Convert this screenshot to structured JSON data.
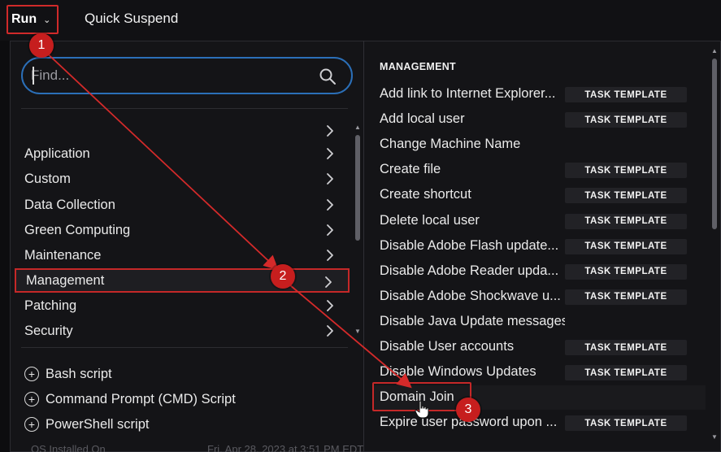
{
  "topbar": {
    "run_label": "Run",
    "quick_suspend_label": "Quick Suspend"
  },
  "search": {
    "placeholder": "Find..."
  },
  "categories": [
    {
      "label": ""
    },
    {
      "label": "Application"
    },
    {
      "label": "Custom"
    },
    {
      "label": "Data Collection"
    },
    {
      "label": "Green Computing"
    },
    {
      "label": "Maintenance"
    },
    {
      "label": "Management",
      "selected": true
    },
    {
      "label": "Patching"
    },
    {
      "label": "Security"
    }
  ],
  "scripts": [
    {
      "label": "Bash script"
    },
    {
      "label": "Command Prompt (CMD) Script"
    },
    {
      "label": "PowerShell script"
    }
  ],
  "management": {
    "title": "MANAGEMENT",
    "badge_label": "TASK TEMPLATE",
    "items": [
      {
        "name": "Add link to Internet Explorer...",
        "badge": true
      },
      {
        "name": "Add local user",
        "badge": true
      },
      {
        "name": "Change Machine Name",
        "badge": false
      },
      {
        "name": "Create file",
        "badge": true
      },
      {
        "name": "Create shortcut",
        "badge": true
      },
      {
        "name": "Delete local user",
        "badge": true
      },
      {
        "name": "Disable Adobe Flash update...",
        "badge": true
      },
      {
        "name": "Disable Adobe Reader upda...",
        "badge": true
      },
      {
        "name": "Disable Adobe Shockwave u...",
        "badge": true
      },
      {
        "name": "Disable Java Update messages",
        "badge": false
      },
      {
        "name": "Disable User accounts",
        "badge": true
      },
      {
        "name": "Disable Windows Updates",
        "badge": true
      },
      {
        "name": "Domain Join",
        "badge": false,
        "selected": true
      },
      {
        "name": "Expire user password upon ...",
        "badge": true
      }
    ]
  },
  "annotations": {
    "step1": "1",
    "step2": "2",
    "step3": "3",
    "color": "#c61e1e"
  },
  "background": {
    "left_text": "OS Installed On",
    "right_text": "Fri, Apr 28, 2023 at 3:51 PM EDT"
  }
}
